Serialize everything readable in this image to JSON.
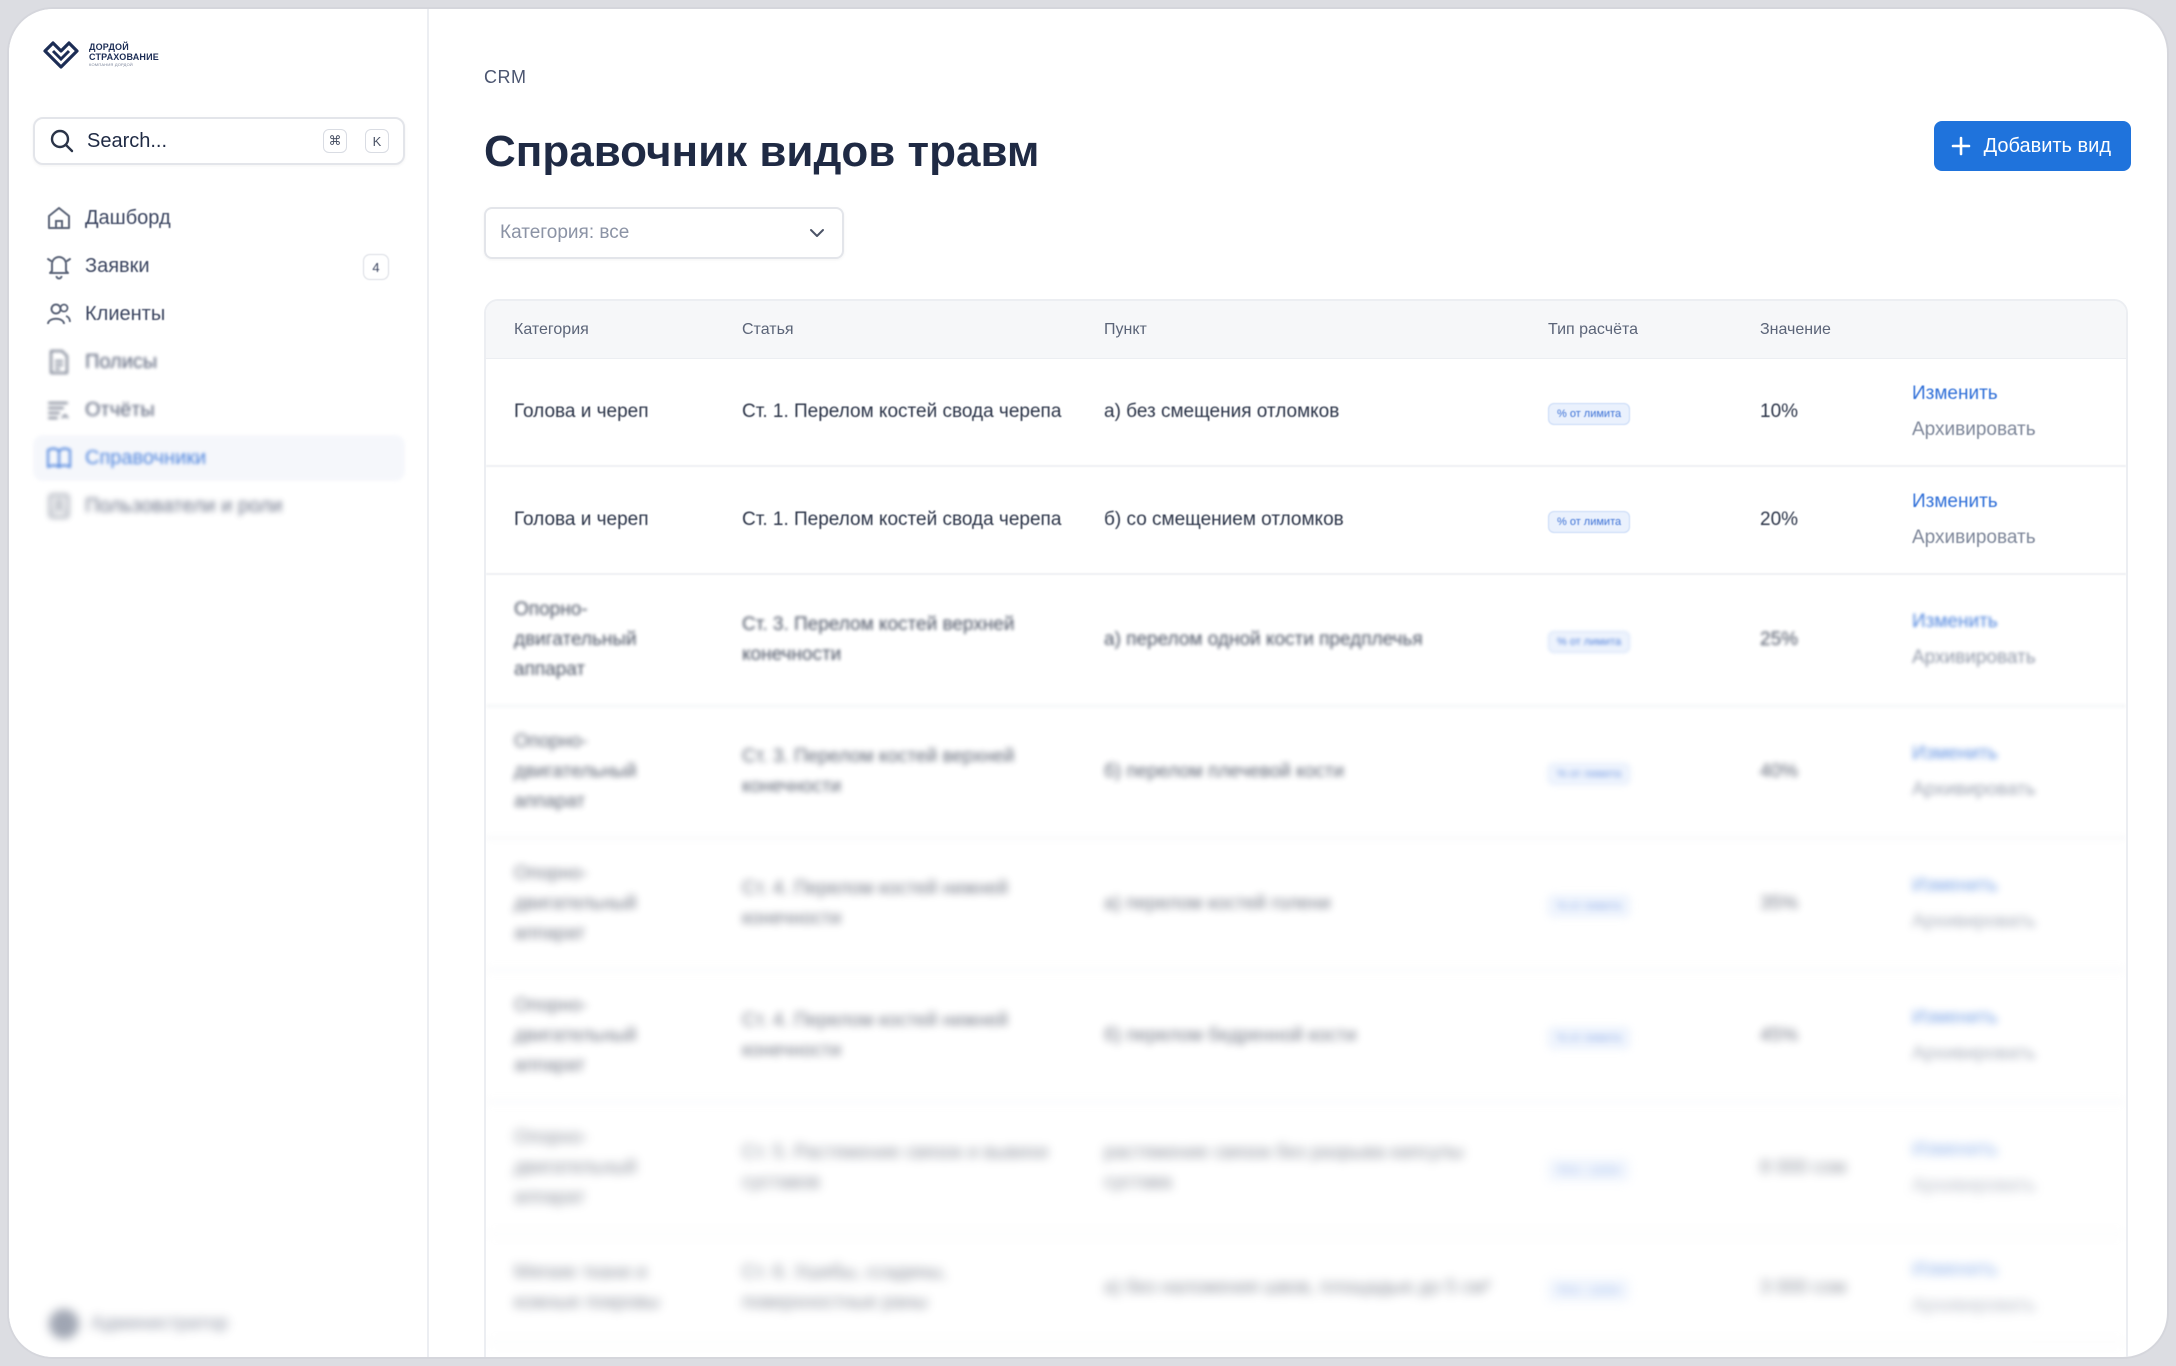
{
  "brand": {
    "line1": "ДОРДОЙ",
    "line2": "СТРАХОВАНИЕ",
    "line3": "КОМПАНИЯ ДОРДОЙ"
  },
  "search": {
    "placeholder": "Search...",
    "shortcut_mod": "⌘",
    "shortcut_key": "K"
  },
  "sidebar": {
    "items": [
      {
        "label": "Дашборд",
        "icon": "home-icon"
      },
      {
        "label": "Заявки",
        "icon": "bell-icon",
        "badge": "4"
      },
      {
        "label": "Клиенты",
        "icon": "users-icon"
      },
      {
        "label": "Полисы",
        "icon": "document-icon"
      },
      {
        "label": "Отчёты",
        "icon": "report-icon"
      },
      {
        "label": "Справочники",
        "icon": "book-icon",
        "active": true
      },
      {
        "label": "Пользователи и роли",
        "icon": "id-card-icon"
      }
    ],
    "user": {
      "name": "Администратор"
    }
  },
  "main": {
    "breadcrumb": "CRM",
    "title": "Справочник видов травм",
    "add_button": "Добавить вид",
    "filter_placeholder": "Категория: все"
  },
  "table": {
    "columns": [
      "Категория",
      "Статья",
      "Пункт",
      "Тип расчёта",
      "Значение",
      ""
    ],
    "rows": [
      {
        "category": "Голова и череп",
        "article": "Ст. 1. Перелом костей свода черепа",
        "item": "а) без смещения отломков",
        "calc_type": "% от лимита",
        "value": "10%",
        "edit": "Изменить",
        "archive": "Архивировать"
      },
      {
        "category": "Голова и череп",
        "article": "Ст. 1. Перелом костей свода черепа",
        "item": "б) со смещением отломков",
        "calc_type": "% от лимита",
        "value": "20%",
        "edit": "Изменить",
        "archive": "Архивировать"
      },
      {
        "category": "Опорно-двигательный аппарат",
        "article": "Ст. 3. Перелом костей верхней конечности",
        "item": "а) перелом одной кости предплечья",
        "calc_type": "% от лимита",
        "value": "25%",
        "edit": "Изменить",
        "archive": "Архивировать"
      },
      {
        "category": "Опорно-двигательный аппарат",
        "article": "Ст. 3. Перелом костей верхней конечности",
        "item": "б) перелом плечевой кости",
        "calc_type": "% от лимита",
        "value": "40%",
        "edit": "Изменить",
        "archive": "Архивировать"
      },
      {
        "category": "Опорно-двигательный аппарат",
        "article": "Ст. 4. Перелом костей нижней конечности",
        "item": "а) перелом костей голени",
        "calc_type": "% от лимита",
        "value": "35%",
        "edit": "Изменить",
        "archive": "Архивировать"
      },
      {
        "category": "Опорно-двигательный аппарат",
        "article": "Ст. 4. Перелом костей нижней конечности",
        "item": "б) перелом бедренной кости",
        "calc_type": "% от лимита",
        "value": "45%",
        "edit": "Изменить",
        "archive": "Архивировать"
      },
      {
        "category": "Опорно-двигательный аппарат",
        "article": "Ст. 5. Растяжение связок и вывихи суставов",
        "item": "растяжение связок без разрыва капсулы сустава",
        "calc_type": "Фикс. сумма",
        "value": "8 000 сом",
        "edit": "Изменить",
        "archive": "Архивировать"
      },
      {
        "category": "Мягкие ткани и кожные покровы",
        "article": "Ст. 6. Ушибы, ссадины, поверхностные раны",
        "item": "а) без наложения швов, площадью до 5 см²",
        "calc_type": "Фикс. сумма",
        "value": "3 000 сом",
        "edit": "Изменить",
        "archive": "Архивировать"
      }
    ]
  },
  "colors": {
    "accent": "#1f73dc",
    "active_nav": "#2f6fd8",
    "text": "#1f2a44"
  }
}
